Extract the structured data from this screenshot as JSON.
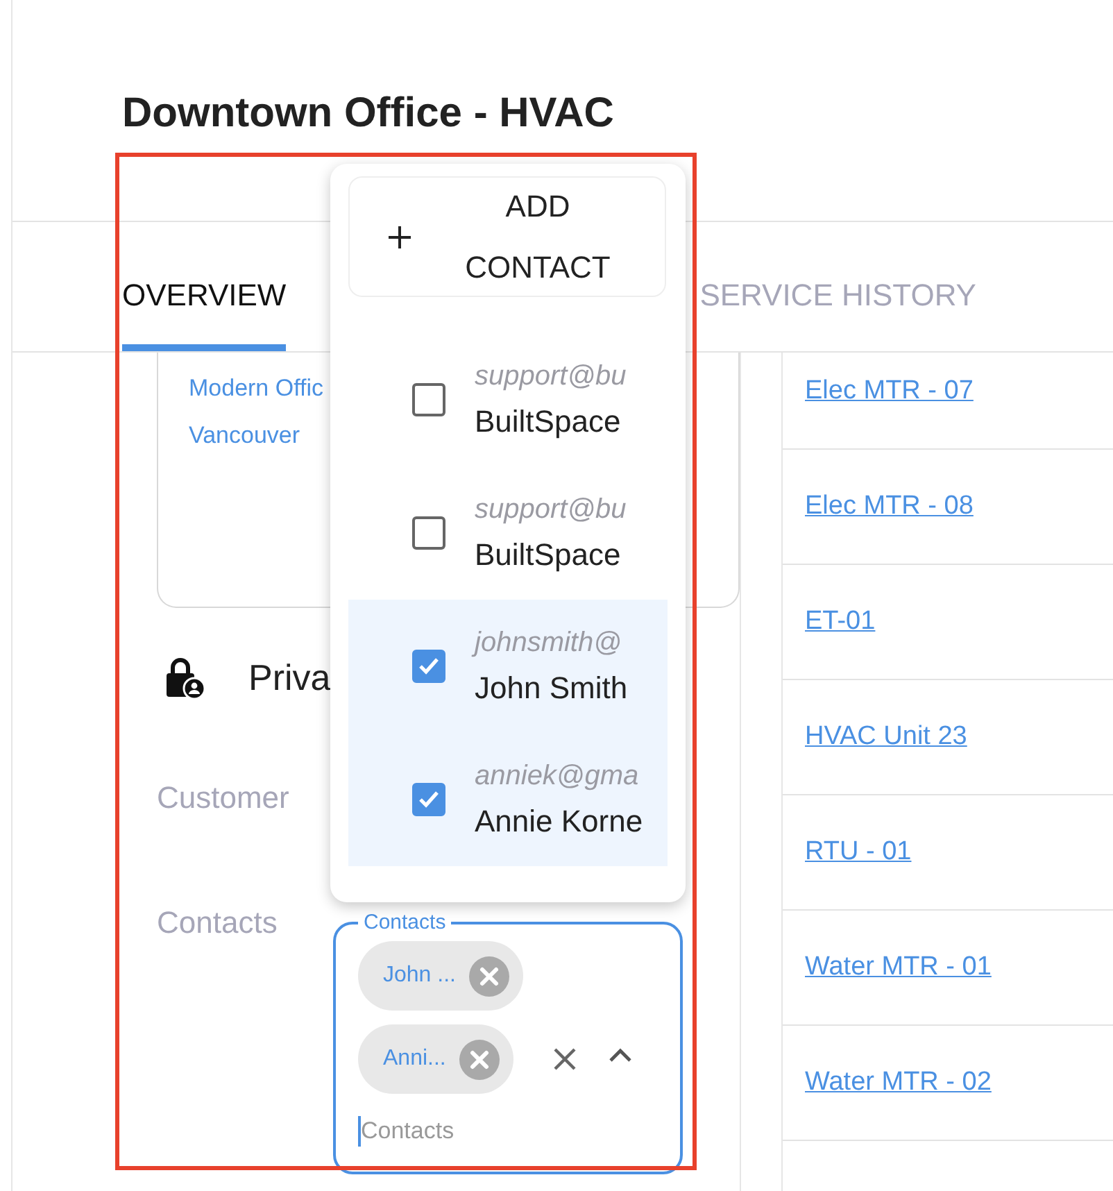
{
  "page": {
    "title": "Downtown Office - HVAC"
  },
  "tabs": [
    {
      "label": "OVERVIEW",
      "selected": true
    },
    {
      "label": "SERVICE HISTORY",
      "selected": false
    }
  ],
  "location_card": {
    "lines": [
      "Modern Offic",
      "Vancouver"
    ]
  },
  "privacy": {
    "label": "Priva"
  },
  "customer": {
    "label": "Customer"
  },
  "contacts": {
    "label": "Contacts",
    "field_label": "Contacts",
    "chips": [
      "John ...",
      "Anni..."
    ],
    "placeholder": "Contacts"
  },
  "contact_menu": {
    "add_button": "ADD CONTACT",
    "items": [
      {
        "email": "support@bu",
        "name": "BuiltSpace",
        "selected": false
      },
      {
        "email": "support@bu",
        "name": "BuiltSpace",
        "selected": false
      },
      {
        "email": "johnsmith@",
        "name": "John Smith",
        "selected": true
      },
      {
        "email": "anniek@gma",
        "name": "Annie Korne",
        "selected": true
      }
    ]
  },
  "assets": [
    "Elec MTR - 07",
    "Elec MTR - 08",
    "ET-01",
    "HVAC Unit 23",
    "RTU - 01",
    "Water MTR - 01",
    "Water MTR - 02"
  ]
}
